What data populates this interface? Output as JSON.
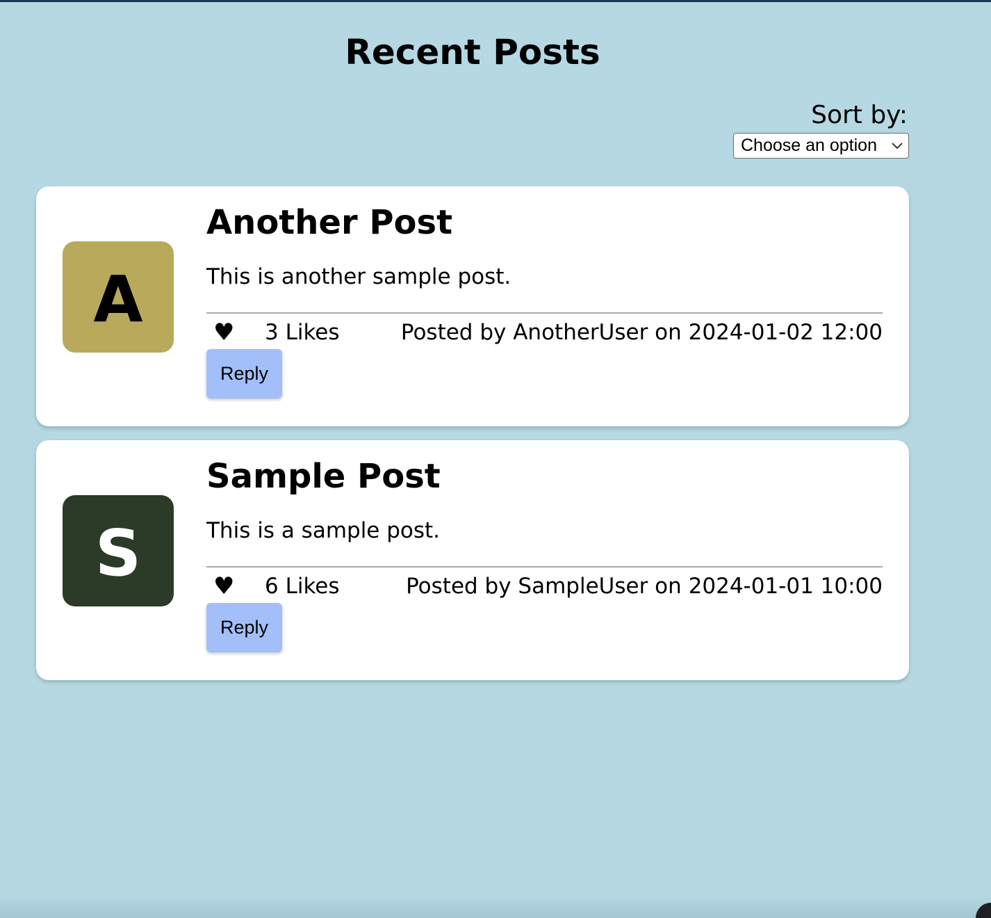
{
  "page": {
    "title": "Recent Posts"
  },
  "sort": {
    "label": "Sort by:",
    "selected": "Choose an option"
  },
  "posts": [
    {
      "avatar_letter": "A",
      "avatar_bg": "#b9aa5b",
      "avatar_fg": "#000000",
      "title": "Another Post",
      "body": "This is another sample post.",
      "likes": "3 Likes",
      "meta": "Posted by AnotherUser on 2024-01-02 12:00",
      "reply_label": "Reply"
    },
    {
      "avatar_letter": "S",
      "avatar_bg": "#2b3b27",
      "avatar_fg": "#ffffff",
      "title": "Sample Post",
      "body": "This is a sample post.",
      "likes": "6 Likes",
      "meta": "Posted by SampleUser on 2024-01-01 10:00",
      "reply_label": "Reply"
    }
  ],
  "icons": {
    "like": "heart-icon",
    "select_arrow": "chevron-down-icon"
  },
  "colors": {
    "page_background": "#b5d8e3",
    "card_background": "#ffffff",
    "reply_button": "#a3bff9"
  }
}
